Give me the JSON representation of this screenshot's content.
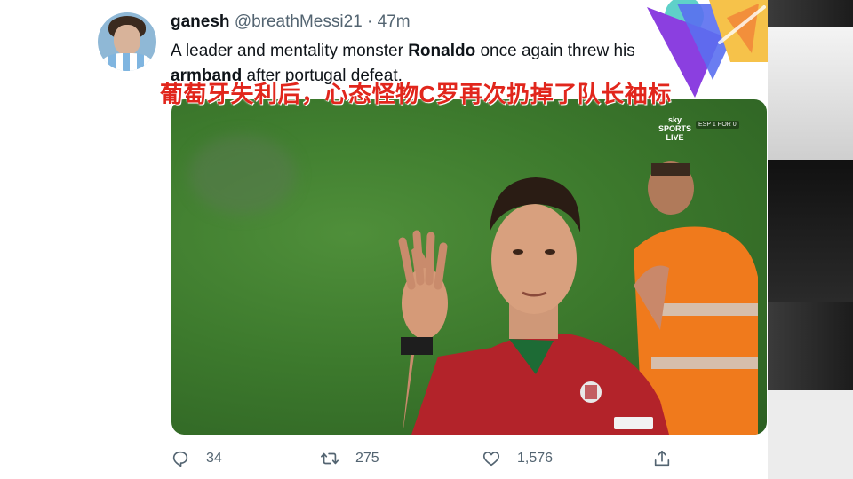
{
  "tweet": {
    "author_name": "ganesh",
    "author_handle": "@breathMessi21",
    "separator": "·",
    "time": "47m",
    "text_part1": "A leader and mentality monster ",
    "text_bold1": "Ronaldo",
    "text_part2": " once again threw his",
    "text_bold2": "armband",
    "text_part3": " after portugal defeat."
  },
  "overlay": {
    "caption": "葡萄牙失利后，心态怪物C罗再次扔掉了队长袖标"
  },
  "media": {
    "broadcaster_line1": "sky",
    "broadcaster_line2": "SPORTS",
    "broadcaster_line3": "LIVE",
    "score_badge": "ESP 1 POR 0"
  },
  "actions": {
    "reply_count": "34",
    "retweet_count": "275",
    "like_count": "1,576",
    "reply_icon": "reply-icon",
    "retweet_icon": "retweet-icon",
    "like_icon": "heart-icon",
    "share_icon": "share-icon"
  },
  "colors": {
    "text_primary": "#0f1419",
    "text_secondary": "#536471",
    "caption_red": "#e1261c",
    "pitch_green": "#3d7a2d",
    "jersey_red": "#b3232a",
    "vest_orange": "#f07a1c"
  }
}
